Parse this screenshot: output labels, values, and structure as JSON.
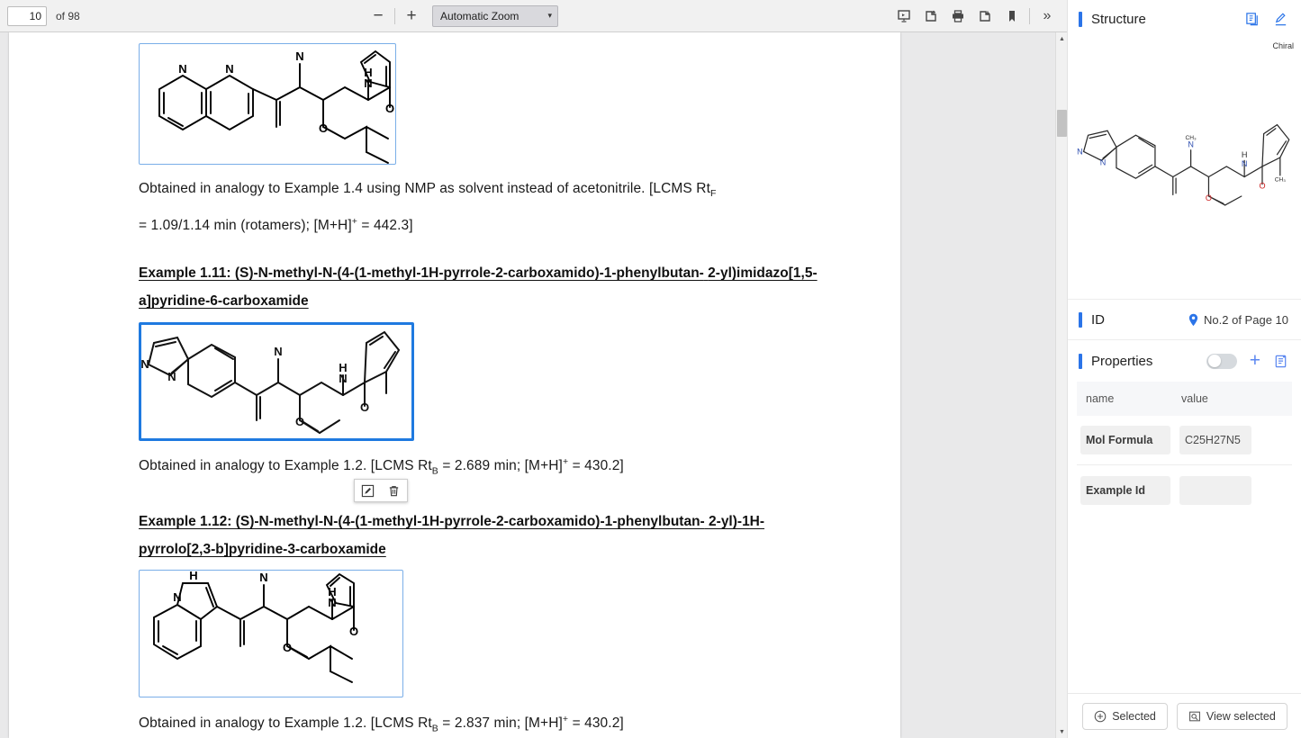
{
  "toolbar": {
    "page_number": "10",
    "page_total": "of 98",
    "zoom_out_label": "−",
    "zoom_in_label": "+",
    "zoom_select_value": "Automatic Zoom",
    "caret": "▾",
    "icons": {
      "presentation": "presentation-mode-icon",
      "open": "open-file-icon",
      "print": "print-icon",
      "save": "save-download-icon",
      "bookmark": "bookmark-icon",
      "more": "»"
    }
  },
  "document": {
    "paragraph_1": "Obtained in analogy to Example 1.4 using NMP as solvent instead of acetonitrile. [LCMS Rt",
    "paragraph_1_sub": "F",
    "paragraph_1_line2_a": "= 1.09/1.14 min (rotamers); [M+H]",
    "paragraph_1_sup": "+",
    "paragraph_1_line2_b": " = 442.3]",
    "heading_111_line1": "Example 1.11: (S)-N-methyl-N-(4-(1-methyl-1H-pyrrole-2-carboxamido)-1-phenylbutan-",
    "heading_111_line2": "2-yl)imidazo[1,5-a]pyridine-6-carboxamide",
    "paragraph_2_a": "Obtained in analogy to Exam",
    "paragraph_2_b": "ple 1.2. [",
    "paragraph_2_c": "LCMS Rt",
    "paragraph_2_sub": "B",
    "paragraph_2_d": " = 2.689 min; [M+H]",
    "paragraph_2_sup": "+",
    "paragraph_2_e": " = 430.2]",
    "heading_112_line1": "Example 1.12: (S)-N-methyl-N-(4-(1-methyl-1H-pyrrole-2-carboxamido)-1-phenylbutan-",
    "heading_112_line2": "2-yl)-1H-pyrrolo[2,3-b]pyridine-3-carboxamide",
    "paragraph_3_a": "Obtained in analogy to Example 1.2. [LCMS Rt",
    "paragraph_3_sub": "B",
    "paragraph_3_b": " = 2.837 min; [M+H]",
    "paragraph_3_sup": "+",
    "paragraph_3_c": " = 430.2]"
  },
  "action_popup": {
    "edit_icon": "edit-pencil-icon",
    "delete_icon": "trash-delete-icon"
  },
  "side_panel": {
    "structure": {
      "title": "Structure",
      "copy_icon": "copy-icon",
      "edit_icon": "pencil-edit-icon",
      "chiral_label": "Chiral",
      "atom_labels": {
        "n": "N",
        "ch3": "CH₃",
        "h": "H",
        "o": "O"
      }
    },
    "id": {
      "title": "ID",
      "location_icon": "location-pin-icon",
      "value": "No.2 of Page 10"
    },
    "properties": {
      "title": "Properties",
      "toggle_state": "off",
      "add_label": "+",
      "paste_icon": "paste-clipboard-icon",
      "columns": [
        "name",
        "value"
      ],
      "rows": [
        {
          "name": "Mol Formula",
          "value": "C25H27N5"
        },
        {
          "name": "Example Id",
          "value": ""
        }
      ]
    },
    "footer": {
      "selected_label": "Selected",
      "selected_icon": "circle-plus-icon",
      "view_selected_label": "View selected",
      "view_selected_icon": "view-frame-icon"
    }
  },
  "colors": {
    "accent": "#2b74e8",
    "selection_border": "#1f7ae0",
    "structure_border": "#7aaee8",
    "nitrogen": "#2f4fb0",
    "oxygen": "#cc2222"
  }
}
